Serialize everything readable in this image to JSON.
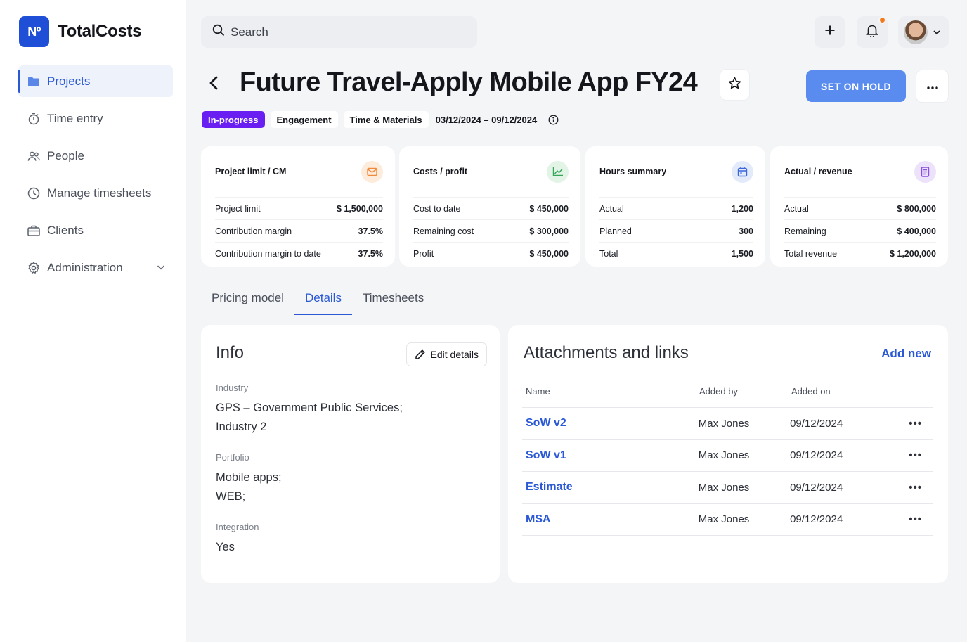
{
  "app": {
    "logo_mark": "Nº",
    "name": "TotalCosts"
  },
  "sidebar": {
    "items": [
      {
        "label": "Projects",
        "icon": "folder-icon",
        "active": true
      },
      {
        "label": "Time entry",
        "icon": "stopwatch-icon"
      },
      {
        "label": "People",
        "icon": "people-icon"
      },
      {
        "label": "Manage timesheets",
        "icon": "clock-icon"
      },
      {
        "label": "Clients",
        "icon": "briefcase-icon"
      },
      {
        "label": "Administration",
        "icon": "gear-icon",
        "expandable": true
      }
    ]
  },
  "topbar": {
    "search_placeholder": "Search",
    "has_notification": true,
    "notification_color": "#f07a1c"
  },
  "project": {
    "title": "Future Travel-Apply Mobile App FY24",
    "primary_action": "SET ON HOLD",
    "tags": {
      "status": "In-progress",
      "type": "Engagement",
      "billing": "Time & Materials"
    },
    "dates": "03/12/2024 – 09/12/2024"
  },
  "cards": [
    {
      "title": "Project limit / CM",
      "icon": "envelope-icon",
      "icon_color": "#f08a3c",
      "icon_bg": "#fdebdc",
      "rows": [
        {
          "label": "Project limit",
          "value": "$ 1,500,000"
        },
        {
          "label": "Contribution margin",
          "value": "37.5%"
        },
        {
          "label": "Contribution margin to date",
          "value": "37.5%"
        }
      ]
    },
    {
      "title": "Costs / profit",
      "icon": "trend-chart-icon",
      "icon_color": "#36a65a",
      "icon_bg": "#e2f4e6",
      "rows": [
        {
          "label": "Cost to date",
          "value": "$ 450,000"
        },
        {
          "label": "Remaining cost",
          "value": "$ 300,000"
        },
        {
          "label": "Profit",
          "value": "$ 450,000"
        }
      ]
    },
    {
      "title": "Hours summary",
      "icon": "calendar-icon",
      "icon_color": "#3a66d8",
      "icon_bg": "#e3ebfb",
      "rows": [
        {
          "label": "Actual",
          "value": "1,200"
        },
        {
          "label": "Planned",
          "value": "300"
        },
        {
          "label": "Total",
          "value": "1,500"
        }
      ]
    },
    {
      "title": "Actual / revenue",
      "icon": "receipt-icon",
      "icon_color": "#8a4fe0",
      "icon_bg": "#ece3fb",
      "rows": [
        {
          "label": "Actual",
          "value": "$ 800,000"
        },
        {
          "label": "Remaining",
          "value": "$ 400,000"
        },
        {
          "label": "Total revenue",
          "value": "$ 1,200,000"
        }
      ]
    }
  ],
  "tabs": [
    {
      "label": "Pricing model"
    },
    {
      "label": "Details",
      "active": true
    },
    {
      "label": "Timesheets"
    }
  ],
  "info": {
    "title": "Info",
    "edit_label": "Edit details",
    "fields": [
      {
        "label": "Industry",
        "lines": [
          "GPS – Government Public Services;",
          "Industry 2"
        ]
      },
      {
        "label": "Portfolio",
        "lines": [
          "Mobile apps;",
          "WEB;"
        ]
      },
      {
        "label": "Integration",
        "lines": [
          "Yes"
        ]
      }
    ]
  },
  "attachments": {
    "title": "Attachments and links",
    "add_label": "Add new",
    "columns": {
      "name": "Name",
      "added_by": "Added by",
      "added_on": "Added on"
    },
    "rows": [
      {
        "name": "SoW v2",
        "added_by": "Max Jones",
        "added_on": "09/12/2024"
      },
      {
        "name": "SoW v1",
        "added_by": "Max Jones",
        "added_on": "09/12/2024"
      },
      {
        "name": "Estimate",
        "added_by": "Max Jones",
        "added_on": "09/12/2024"
      },
      {
        "name": "MSA",
        "added_by": "Max Jones",
        "added_on": "09/12/2024"
      }
    ]
  },
  "colors": {
    "accent": "#2b59d6",
    "status_tag": "#6a1ff2",
    "primary_button": "#5a8cf0"
  }
}
